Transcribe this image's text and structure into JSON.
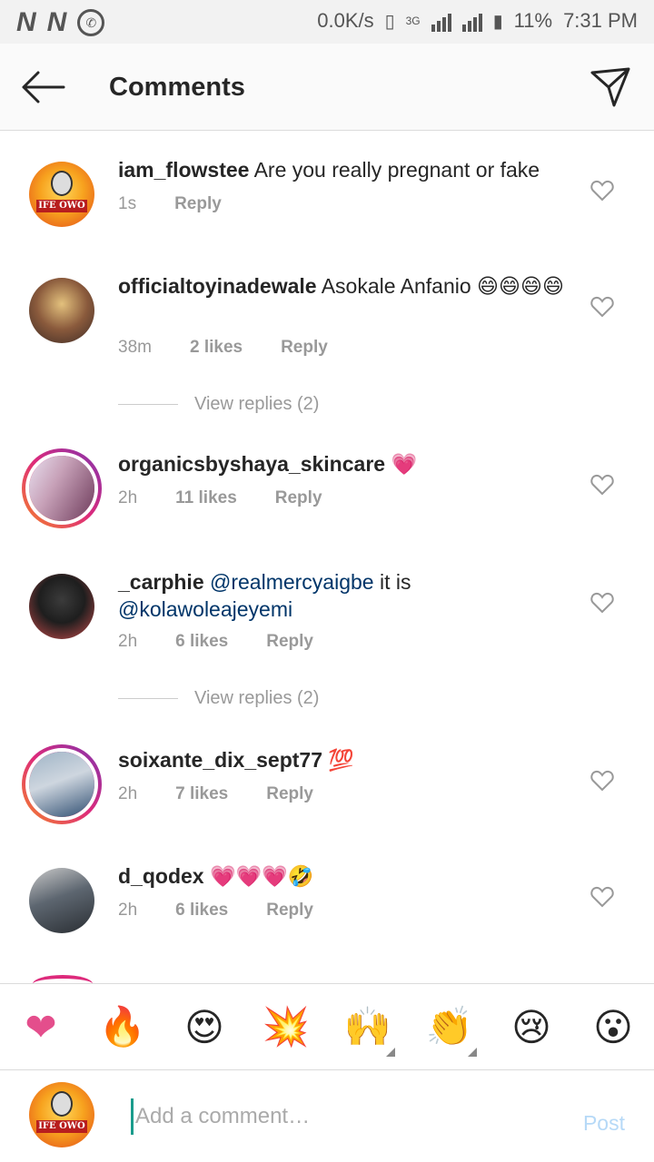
{
  "status_bar": {
    "left_icons": [
      "N",
      "N"
    ],
    "net_speed": "0.0K/s",
    "network": "3G",
    "battery": "11%",
    "time": "7:31 PM"
  },
  "header": {
    "title": "Comments"
  },
  "comments": [
    {
      "user": "iam_flowstee",
      "text": "Are you really pregnant or fake",
      "time": "1s",
      "likes": "",
      "reply": "Reply",
      "avatar_text": "IFE OWO"
    },
    {
      "user": "officialtoyinadewale",
      "text": "Asokale Anfanio 😄😄😄😄",
      "time": "38m",
      "likes": "2 likes",
      "reply": "Reply",
      "view_replies": "View replies (2)"
    },
    {
      "user": "organicsbyshaya_skincare",
      "text": "💗",
      "time": "2h",
      "likes": "11 likes",
      "reply": "Reply"
    },
    {
      "user": "_carphie",
      "mention1": "@realmercyaigbe",
      "text_mid": " it is ",
      "mention2": "@kolawoleajeyemi",
      "time": "2h",
      "likes": "6 likes",
      "reply": "Reply",
      "view_replies": "View replies (2)"
    },
    {
      "user": "soixante_dix_sept77",
      "text": "💯",
      "time": "2h",
      "likes": "7 likes",
      "reply": "Reply"
    },
    {
      "user": "d_qodex",
      "text": "💗💗💗🤣",
      "time": "2h",
      "likes": "6 likes",
      "reply": "Reply"
    }
  ],
  "reactions": [
    "❤",
    "🔥",
    "😍",
    "💥",
    "🙌",
    "👏",
    "😢",
    "😮"
  ],
  "compose": {
    "placeholder": "Add a comment…",
    "post_label": "Post",
    "avatar_text": "IFE OWO"
  },
  "colors": {
    "mention": "#003569",
    "post_disabled": "#b6d9f7",
    "heart": "#e44e8c"
  }
}
